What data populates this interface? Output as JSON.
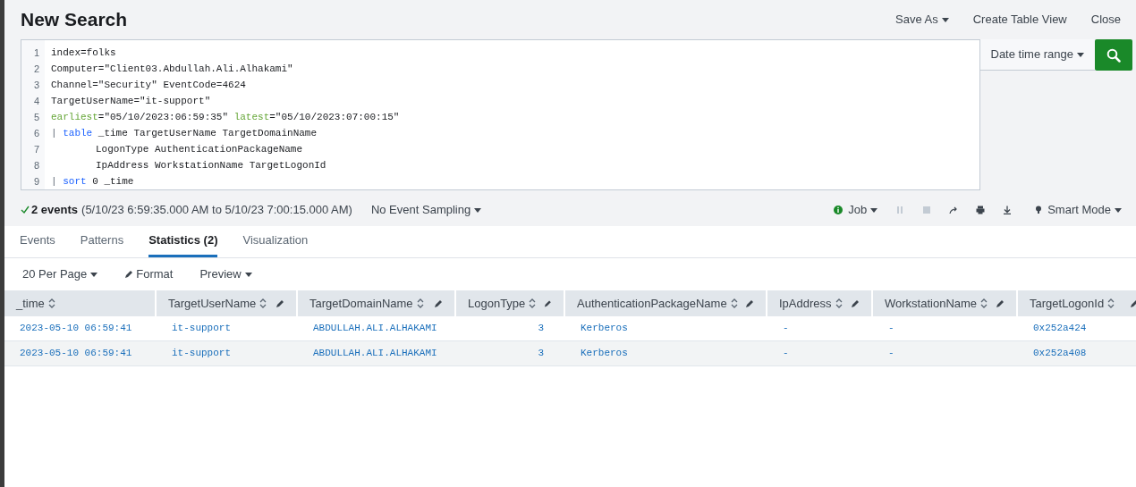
{
  "header": {
    "title": "New Search",
    "actions": [
      {
        "label": "Save As",
        "dropdown": true
      },
      {
        "label": "Create Table View",
        "dropdown": false
      },
      {
        "label": "Close",
        "dropdown": false
      }
    ]
  },
  "query": {
    "lines": [
      {
        "number": "1",
        "indent": false,
        "tokens": [
          {
            "kind": "plain",
            "text": "index=folks"
          }
        ]
      },
      {
        "number": "2",
        "indent": false,
        "tokens": [
          {
            "kind": "plain",
            "text": "Computer=\"Client03.Abdullah.Ali.Alhakami\""
          }
        ]
      },
      {
        "number": "3",
        "indent": false,
        "tokens": [
          {
            "kind": "plain",
            "text": "Channel=\"Security\" EventCode=4624"
          }
        ]
      },
      {
        "number": "4",
        "indent": false,
        "tokens": [
          {
            "kind": "plain",
            "text": "TargetUserName=\"it-support\""
          }
        ]
      },
      {
        "number": "5",
        "indent": false,
        "tokens": [
          {
            "kind": "modifier",
            "text": "earliest"
          },
          {
            "kind": "plain",
            "text": "=\"05/10/2023:06:59:35\" "
          },
          {
            "kind": "modifier",
            "text": "latest"
          },
          {
            "kind": "plain",
            "text": "=\"05/10/2023:07:00:15\""
          }
        ]
      },
      {
        "number": "6",
        "indent": false,
        "tokens": [
          {
            "kind": "pipe",
            "text": "| "
          },
          {
            "kind": "command",
            "text": "table"
          },
          {
            "kind": "plain",
            "text": " _time TargetUserName TargetDomainName"
          }
        ]
      },
      {
        "number": "7",
        "indent": true,
        "tokens": [
          {
            "kind": "plain",
            "text": "LogonType AuthenticationPackageName"
          }
        ]
      },
      {
        "number": "8",
        "indent": true,
        "tokens": [
          {
            "kind": "plain",
            "text": "IpAddress WorkstationName TargetLogonId"
          }
        ]
      },
      {
        "number": "9",
        "indent": false,
        "tokens": [
          {
            "kind": "pipe",
            "text": "| "
          },
          {
            "kind": "command",
            "text": "sort"
          },
          {
            "kind": "plain",
            "text": " 0 _time"
          }
        ]
      }
    ],
    "time_range": "Date time range"
  },
  "status": {
    "count": "2 events",
    "range": "(5/10/23 6:59:35.000 AM to 5/10/23 7:00:15.000 AM)",
    "sampling": "No Event Sampling",
    "job": "Job",
    "mode": "Smart Mode"
  },
  "tabs": [
    {
      "label": "Events",
      "selected": false
    },
    {
      "label": "Patterns",
      "selected": false
    },
    {
      "label": "Statistics (2)",
      "selected": true
    },
    {
      "label": "Visualization",
      "selected": false
    }
  ],
  "table_controls": [
    {
      "label": "20 Per Page",
      "kind": "dropdown"
    },
    {
      "label": "Format",
      "kind": "edit"
    },
    {
      "label": "Preview",
      "kind": "dropdown"
    }
  ],
  "table": {
    "columns": [
      {
        "name": "_time",
        "editable": false,
        "kind": "text"
      },
      {
        "name": "TargetUserName",
        "editable": true,
        "kind": "text"
      },
      {
        "name": "TargetDomainName",
        "editable": true,
        "kind": "text"
      },
      {
        "name": "LogonType",
        "editable": true,
        "kind": "number"
      },
      {
        "name": "AuthenticationPackageName",
        "editable": true,
        "kind": "text"
      },
      {
        "name": "IpAddress",
        "editable": true,
        "kind": "text"
      },
      {
        "name": "WorkstationName",
        "editable": true,
        "kind": "text"
      },
      {
        "name": "TargetLogonId",
        "editable": true,
        "kind": "text"
      }
    ],
    "rows": [
      [
        "2023-05-10 06:59:41",
        "it-support",
        "ABDULLAH.ALI.ALHAKAMI",
        "3",
        "Kerberos",
        "-",
        "-",
        "0x252a424"
      ],
      [
        "2023-05-10 06:59:41",
        "it-support",
        "ABDULLAH.ALI.ALHAKAMI",
        "3",
        "Kerberos",
        "-",
        "-",
        "0x252a408"
      ]
    ]
  }
}
